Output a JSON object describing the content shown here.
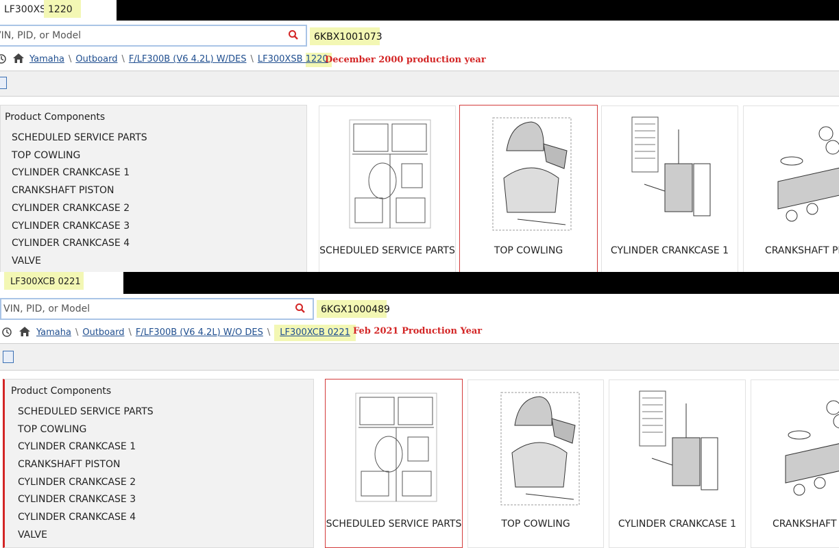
{
  "top": {
    "model_prefix": "LF300XSB ",
    "model_code": "1220",
    "search_placeholder": "VIN, PID, or Model",
    "vin": "6KBX1001073",
    "breadcrumbs": [
      "Yamaha",
      "Outboard",
      "F/LF300B (V6 4.2L) W/DES",
      "LF300XSB "
    ],
    "breadcrumb_last_code": "1220",
    "production_note": "December 2000 production year",
    "sidebar_title": "Product Components",
    "components": [
      "SCHEDULED SERVICE PARTS",
      "TOP COWLING",
      "CYLINDER CRANKCASE 1",
      "CRANKSHAFT PISTON",
      "CYLINDER CRANKCASE 2",
      "CYLINDER CRANKCASE 3",
      "CYLINDER CRANKCASE 4",
      "VALVE"
    ],
    "cards": [
      "SCHEDULED SERVICE PARTS",
      "TOP COWLING",
      "CYLINDER CRANKCASE 1",
      "CRANKSHAFT PISTON"
    ]
  },
  "bottom": {
    "model": "LF300XCB 0221",
    "search_placeholder": "VIN, PID, or Model",
    "vin": "6KGX1000489",
    "breadcrumbs": [
      "Yamaha",
      "Outboard",
      "F/LF300B (V6 4.2L) W/O DES",
      "LF300XCB 0221"
    ],
    "production_note": "Feb 2021 Production Year",
    "sidebar_title": "Product Components",
    "components": [
      "SCHEDULED SERVICE PARTS",
      "TOP COWLING",
      "CYLINDER CRANKCASE 1",
      "CRANKSHAFT PISTON",
      "CYLINDER CRANKCASE 2",
      "CYLINDER CRANKCASE 3",
      "CYLINDER CRANKCASE 4",
      "VALVE"
    ],
    "cards": [
      "SCHEDULED SERVICE PARTS",
      "TOP COWLING",
      "CYLINDER CRANKCASE 1",
      "CRANKSHAFT PISTON"
    ]
  },
  "icons": {
    "search": "search-icon",
    "history": "history-icon",
    "home": "home-icon",
    "list_view": "list-view-icon"
  },
  "colors": {
    "highlight": "#f3f7b4",
    "production_note": "#d32525",
    "selected_card_border": "#d33a3a",
    "search_border": "#a9c4e6",
    "link": "#1f4e8f"
  }
}
